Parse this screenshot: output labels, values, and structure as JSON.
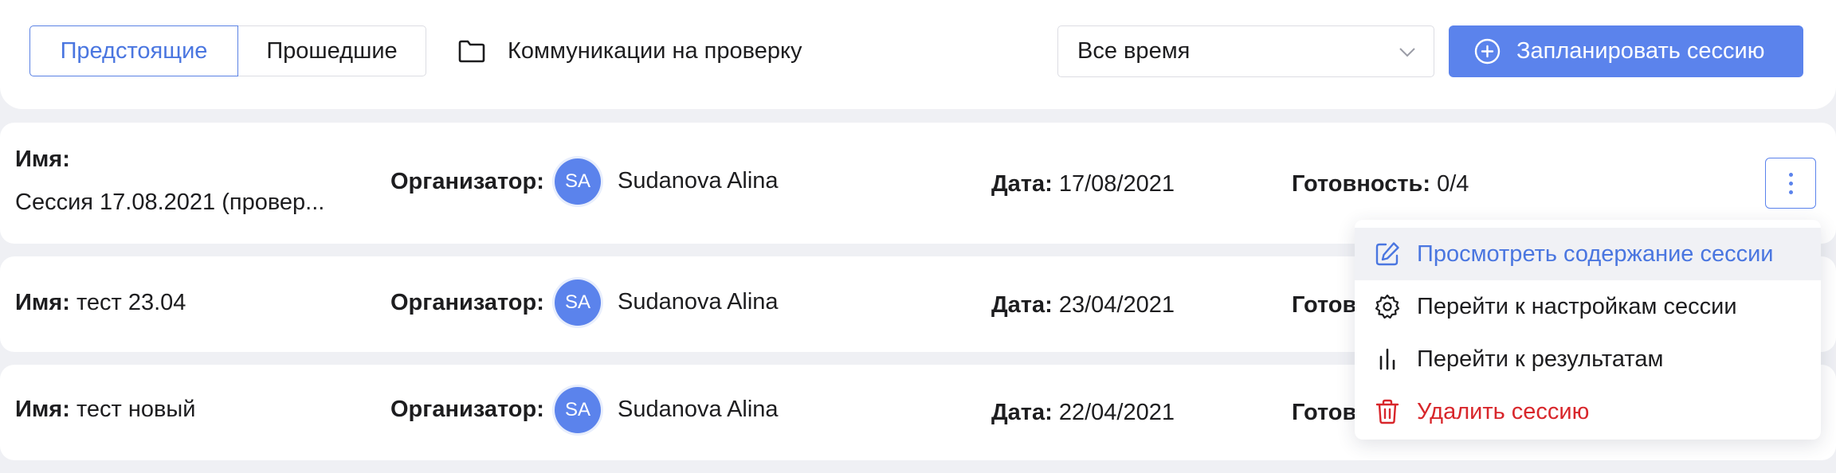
{
  "toolbar": {
    "tabs": [
      {
        "label": "Предстоящие",
        "active": true
      },
      {
        "label": "Прошедшие",
        "active": false
      }
    ],
    "review_link": "Коммуникации на проверку",
    "period": {
      "selected": "Все время"
    },
    "plan_button": "Запланировать сессию",
    "accent_color": "#5b83ec"
  },
  "labels": {
    "name": "Имя:",
    "organizer": "Организатор:",
    "date": "Дата:",
    "readiness": "Готовность:",
    "readiness_cut": "Готов"
  },
  "sessions": [
    {
      "name": "Сессия 17.08.2021 (провер...",
      "initials": "SA",
      "organizer": "Sudanova Alina",
      "date": "17/08/2021",
      "readiness": "0/4"
    },
    {
      "name": "тест 23.04",
      "initials": "SA",
      "organizer": "Sudanova Alina",
      "date": "23/04/2021"
    },
    {
      "name": "тест новый",
      "initials": "SA",
      "organizer": "Sudanova Alina",
      "date": "22/04/2021"
    }
  ],
  "context_menu": {
    "items": [
      {
        "label": "Просмотреть содержание сессии",
        "icon": "edit-icon",
        "highlighted": true
      },
      {
        "label": "Перейти к настройкам сессии",
        "icon": "gear-icon"
      },
      {
        "label": "Перейти к результатам",
        "icon": "bar-chart-icon"
      },
      {
        "label": "Удалить сессию",
        "icon": "trash-icon",
        "color": "#d8262b"
      }
    ]
  }
}
